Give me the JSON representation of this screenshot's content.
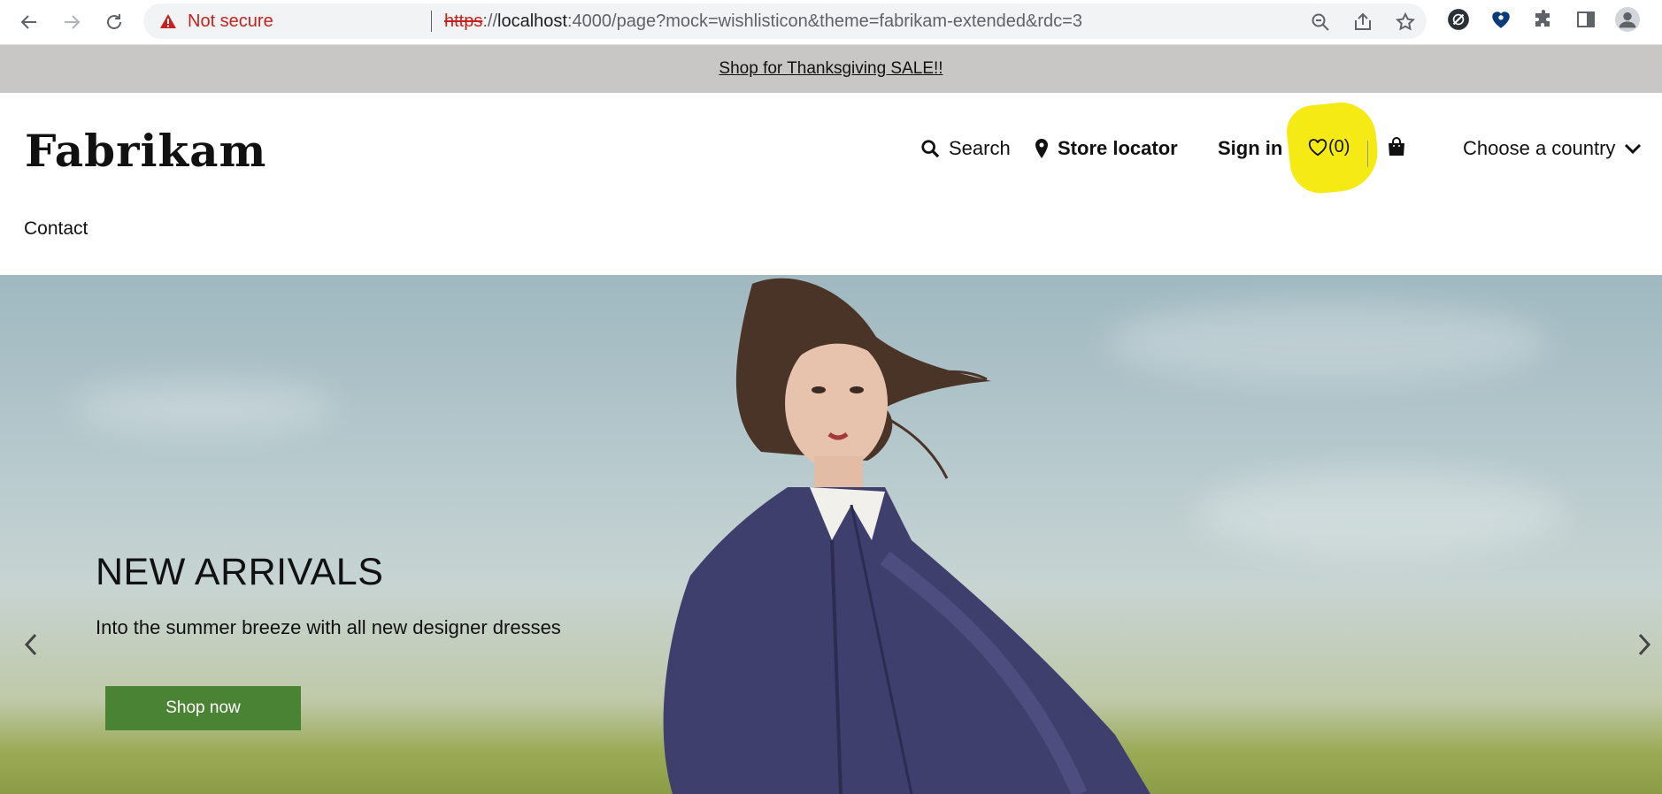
{
  "browser": {
    "security_label": "Not secure",
    "url_scheme": "https",
    "url_sep": "://",
    "url_host": "localhost",
    "url_rest": ":4000/page?mock=wishlisticon&theme=fabrikam-extended&rdc=3"
  },
  "promo": {
    "text": "Shop for Thanksgiving SALE!!"
  },
  "header": {
    "logo": "Fabrikam",
    "search_label": "Search",
    "store_locator_label": "Store locator",
    "sign_in_label": "Sign in",
    "wishlist_count": "(0)",
    "country_label": "Choose a country",
    "nav": [
      {
        "label": "Contact"
      }
    ],
    "highlight_color": "#f5ea14"
  },
  "hero": {
    "title": "NEW ARRIVALS",
    "subtitle": "Into the summer breeze with all new designer dresses",
    "cta_label": "Shop now",
    "cta_color": "#4b8334"
  }
}
